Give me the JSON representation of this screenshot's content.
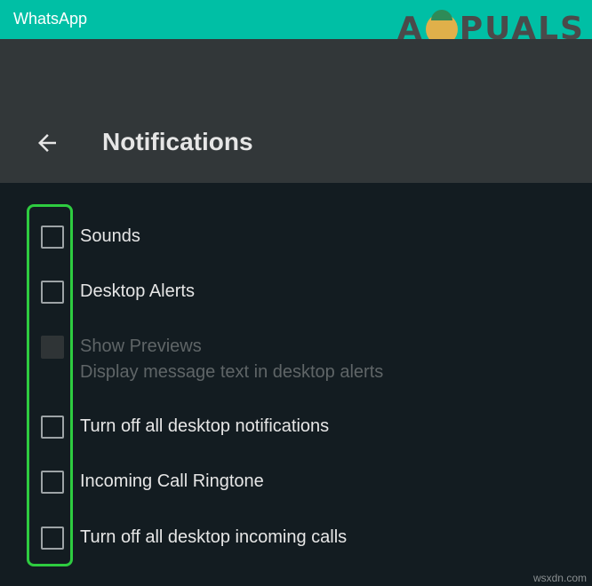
{
  "window": {
    "title": "WhatsApp"
  },
  "watermark": {
    "text_left": "A",
    "text_right": "PUALS"
  },
  "header": {
    "title": "Notifications",
    "back_icon": "arrow-left-icon"
  },
  "items": [
    {
      "label": "Sounds",
      "checked": false,
      "disabled": false
    },
    {
      "label": "Desktop Alerts",
      "checked": false,
      "disabled": false
    },
    {
      "label": "Show Previews",
      "sublabel": "Display message text in desktop alerts",
      "checked": false,
      "disabled": true
    },
    {
      "label": "Turn off all desktop notifications",
      "checked": false,
      "disabled": false
    },
    {
      "label": "Incoming Call Ringtone",
      "checked": false,
      "disabled": false
    },
    {
      "label": "Turn off all desktop incoming calls",
      "checked": false,
      "disabled": false
    }
  ],
  "colors": {
    "titlebar": "#00bfa5",
    "header": "#323739",
    "body": "#131c21",
    "highlight": "#2ecc40"
  },
  "footer": {
    "site": "wsxdn.com"
  }
}
